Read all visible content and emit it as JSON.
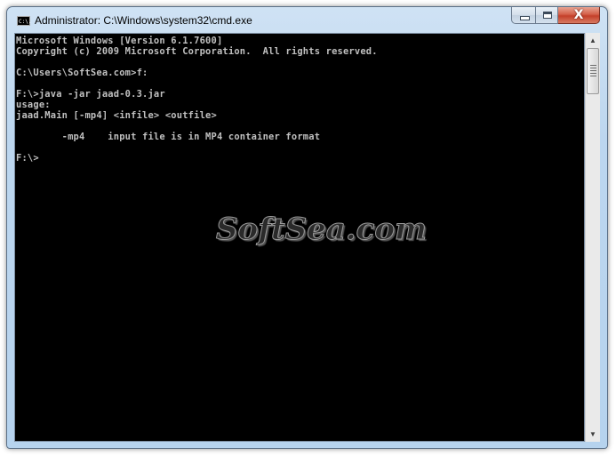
{
  "window": {
    "title": "Administrator: C:\\Windows\\system32\\cmd.exe",
    "app_icon": "console-icon",
    "app_icon_text": "C:\\.",
    "controls": {
      "minimize_icon": "minimize-icon",
      "maximize_icon": "maximize-icon",
      "close_icon": "close-icon",
      "close_glyph": "X"
    }
  },
  "console": {
    "lines": [
      "Microsoft Windows [Version 6.1.7600]",
      "Copyright (c) 2009 Microsoft Corporation.  All rights reserved.",
      "",
      "C:\\Users\\SoftSea.com>f:",
      "",
      "F:\\>java -jar jaad-0.3.jar",
      "usage:",
      "jaad.Main [-mp4] <infile> <outfile>",
      "",
      "        -mp4    input file is in MP4 container format",
      "",
      "F:\\>"
    ],
    "colors": {
      "background": "#000000",
      "text": "#c0c0c0"
    }
  },
  "watermark": {
    "text": "SoftSea.com"
  },
  "scrollbar": {
    "up_arrow": "▲",
    "down_arrow": "▼"
  }
}
